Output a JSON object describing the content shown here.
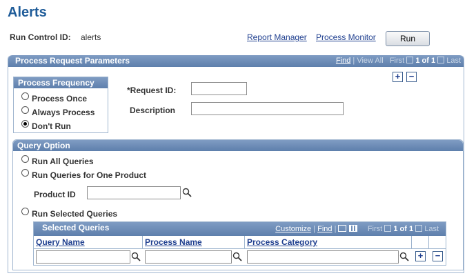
{
  "page": {
    "title": "Alerts"
  },
  "run_control": {
    "label": "Run Control ID:",
    "value": "alerts"
  },
  "links": {
    "report_manager": "Report Manager",
    "process_monitor": "Process Monitor"
  },
  "run_button": "Run",
  "params": {
    "title": "Process Request Parameters",
    "nav": {
      "find": "Find",
      "sep": "|",
      "view_all": "View All",
      "first": "First",
      "count": "1 of 1",
      "last": "Last"
    }
  },
  "frequency": {
    "title": "Process Frequency",
    "options": [
      "Process Once",
      "Always Process",
      "Don't Run"
    ],
    "selected": "Don't Run"
  },
  "request": {
    "label": "*Request ID:",
    "value": ""
  },
  "description": {
    "label": "Description",
    "value": ""
  },
  "query_option": {
    "title": "Query Option",
    "options": [
      "Run All Queries",
      "Run Queries for One Product",
      "Run Selected Queries"
    ],
    "product_label": "Product ID",
    "product_value": ""
  },
  "selected_queries": {
    "title": "Selected Queries",
    "nav": {
      "customize": "Customize",
      "find": "Find",
      "first": "First",
      "count": "1 of 1",
      "last": "Last"
    },
    "columns": [
      "Query Name",
      "Process Name",
      "Process Category"
    ],
    "row": [
      "",
      "",
      ""
    ]
  },
  "icons": [
    "search-icon",
    "add-row-icon",
    "delete-row-icon",
    "view-grid-icon",
    "download-icon"
  ]
}
